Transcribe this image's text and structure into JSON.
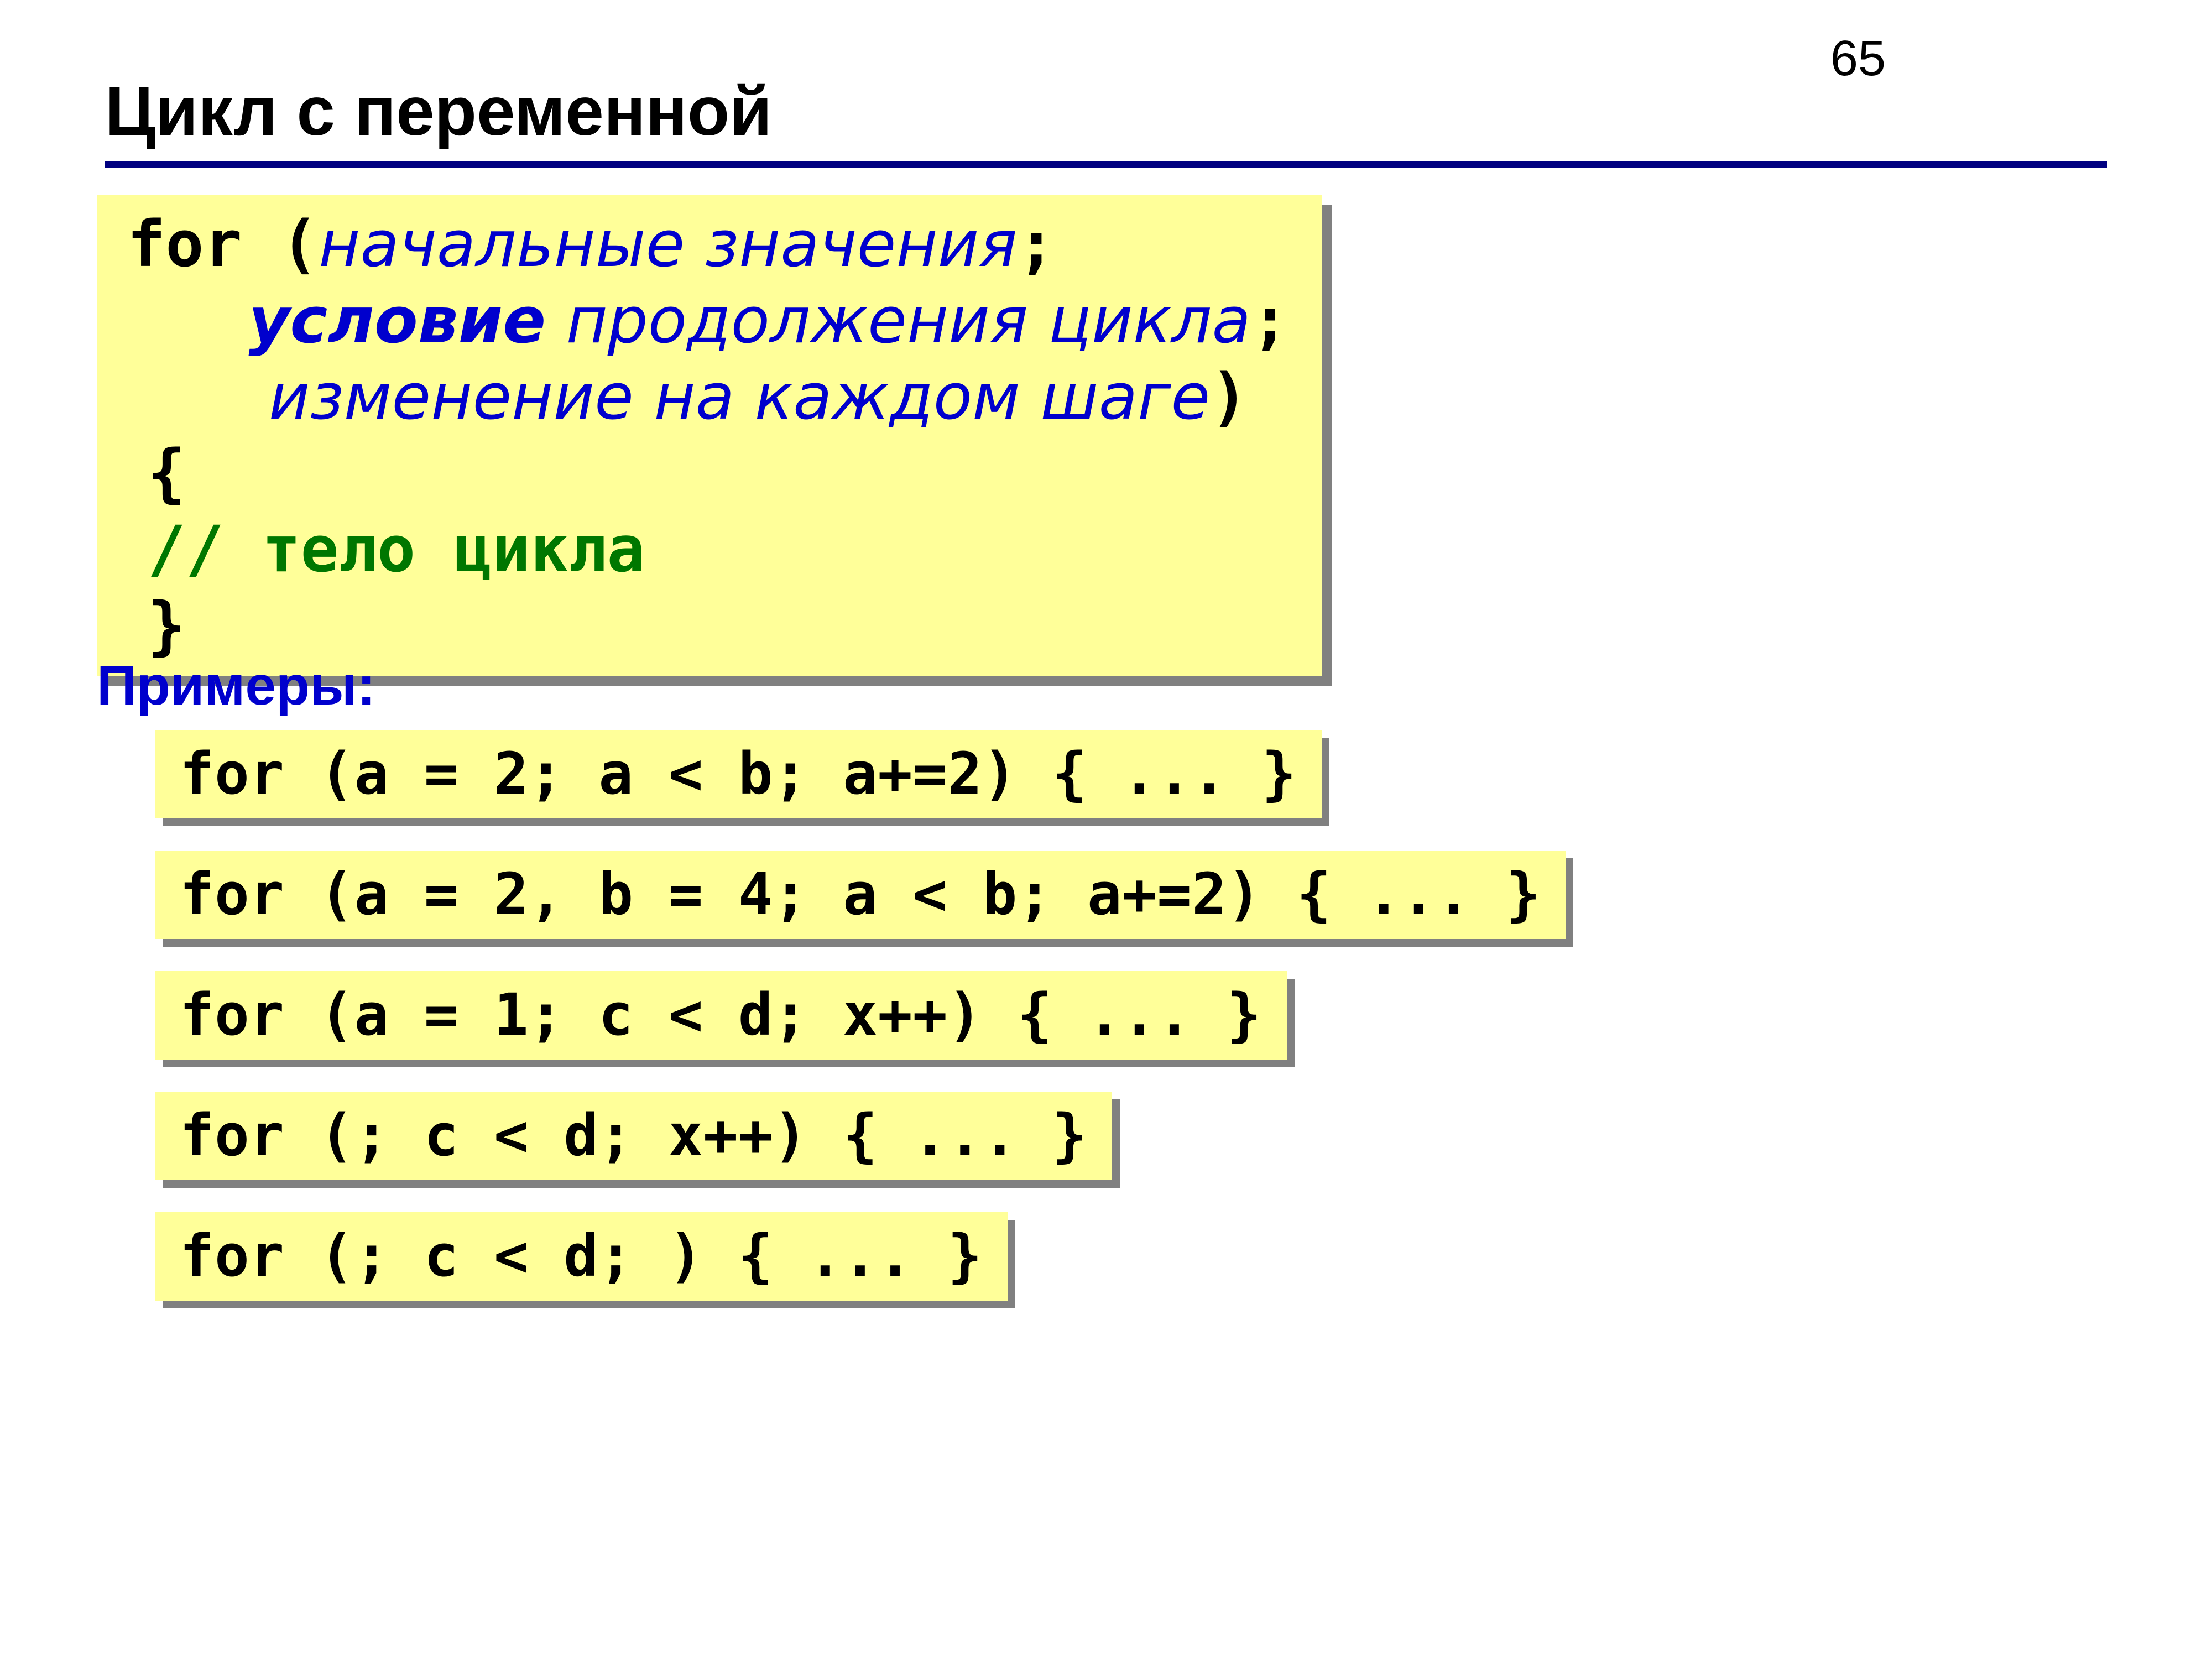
{
  "page_number": "65",
  "title": "Цикл с переменной",
  "syntax": {
    "for": "for ",
    "lparen": "(",
    "init": "начальные значения",
    "semi1": ";",
    "cond_bold": "условие",
    "cond_rest": " продолжения цикла",
    "semi2": ";",
    "step": "изменение на каждом шаге",
    "rparen": ")",
    "lbrace": "{",
    "comment": "// тело цикла",
    "rbrace": "}"
  },
  "examples_label": "Примеры:",
  "examples": [
    "for (a = 2; a < b; a+=2) { ... }",
    "for (a = 2, b = 4; a < b; a+=2) { ... }",
    "for (a = 1; c < d; x++) { ... }",
    "for (; c < d; x++) { ... }",
    "for (; c < d; ) { ... }"
  ]
}
